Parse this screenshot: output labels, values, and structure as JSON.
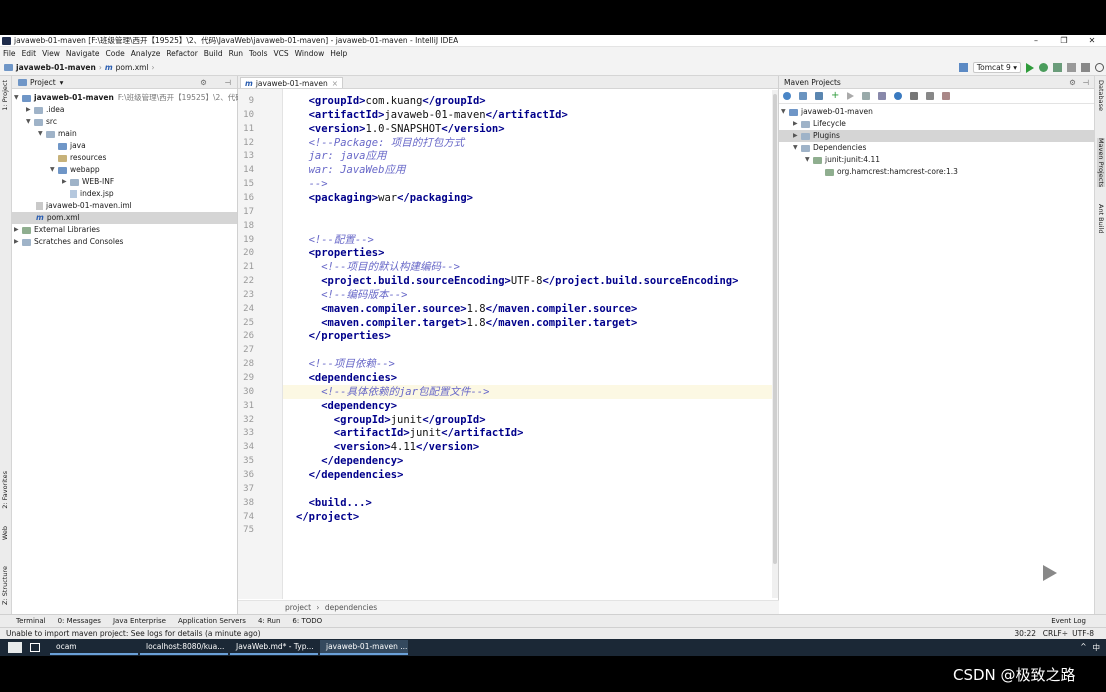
{
  "window": {
    "title": "javaweb-01-maven [F:\\班级管理\\西开【19525】\\2、代码\\JavaWeb\\javaweb-01-maven] - javaweb-01-maven - IntelliJ IDEA",
    "min": "–",
    "max": "❐",
    "close": "✕"
  },
  "menu": [
    "File",
    "Edit",
    "View",
    "Navigate",
    "Code",
    "Analyze",
    "Refactor",
    "Build",
    "Run",
    "Tools",
    "VCS",
    "Window",
    "Help"
  ],
  "nav": {
    "project": "javaweb-01-maven",
    "file": "pom.xml",
    "run_config": "Tomcat 9"
  },
  "left_strip": {
    "project": "1: Project",
    "favorites": "2: Favorites",
    "web": "Web",
    "structure": "Z: Structure"
  },
  "right_strip": {
    "database": "Database",
    "maven": "Maven Projects",
    "ant": "Ant Build"
  },
  "project_panel": {
    "header": "Project",
    "items": [
      {
        "label": "javaweb-01-maven",
        "path": "F:\\班级管理\\西开【19525】\\2、代码\\Java"
      },
      {
        "label": ".idea"
      },
      {
        "label": "src"
      },
      {
        "label": "main"
      },
      {
        "label": "java"
      },
      {
        "label": "resources"
      },
      {
        "label": "webapp"
      },
      {
        "label": "WEB-INF"
      },
      {
        "label": "index.jsp"
      },
      {
        "label": "javaweb-01-maven.iml"
      },
      {
        "label": "pom.xml"
      },
      {
        "label": "External Libraries"
      },
      {
        "label": "Scratches and Consoles"
      }
    ]
  },
  "editor": {
    "tab": "javaweb-01-maven",
    "current_line": 30,
    "lines": [
      {
        "n": "9",
        "parts": [
          [
            "tag",
            "<groupId>"
          ],
          [
            "txt",
            "com.kuang"
          ],
          [
            "tag",
            "</groupId>"
          ]
        ],
        "indent": 1
      },
      {
        "n": "10",
        "parts": [
          [
            "tag",
            "<artifactId>"
          ],
          [
            "txt",
            "javaweb-01-maven"
          ],
          [
            "tag",
            "</artifactId>"
          ]
        ],
        "indent": 1
      },
      {
        "n": "11",
        "parts": [
          [
            "tag",
            "<version>"
          ],
          [
            "txt",
            "1.0-SNAPSHOT"
          ],
          [
            "tag",
            "</version>"
          ]
        ],
        "indent": 1
      },
      {
        "n": "12",
        "parts": [
          [
            "cmt",
            "<!--Package: 项目的打包方式"
          ]
        ],
        "indent": 1
      },
      {
        "n": "13",
        "parts": [
          [
            "cmt",
            "jar: java应用"
          ]
        ],
        "indent": 1
      },
      {
        "n": "14",
        "parts": [
          [
            "cmt",
            "war: JavaWeb应用"
          ]
        ],
        "indent": 1
      },
      {
        "n": "15",
        "parts": [
          [
            "cmt",
            "-->"
          ]
        ],
        "indent": 1
      },
      {
        "n": "16",
        "parts": [
          [
            "tag",
            "<packaging>"
          ],
          [
            "txt",
            "war"
          ],
          [
            "tag",
            "</packaging>"
          ]
        ],
        "indent": 1
      },
      {
        "n": "17",
        "parts": [],
        "indent": 0
      },
      {
        "n": "18",
        "parts": [],
        "indent": 0
      },
      {
        "n": "19",
        "parts": [
          [
            "cmt",
            "<!--配置-->"
          ]
        ],
        "indent": 1
      },
      {
        "n": "20",
        "parts": [
          [
            "tag",
            "<properties>"
          ]
        ],
        "indent": 1
      },
      {
        "n": "21",
        "parts": [
          [
            "cmt",
            "<!--项目的默认构建编码-->"
          ]
        ],
        "indent": 2
      },
      {
        "n": "22",
        "parts": [
          [
            "tag",
            "<project.build.sourceEncoding>"
          ],
          [
            "txt",
            "UTF-8"
          ],
          [
            "tag",
            "</project.build.sourceEncoding>"
          ]
        ],
        "indent": 2
      },
      {
        "n": "23",
        "parts": [
          [
            "cmt",
            "<!--编码版本-->"
          ]
        ],
        "indent": 2
      },
      {
        "n": "24",
        "parts": [
          [
            "tag",
            "<maven.compiler.source>"
          ],
          [
            "txt",
            "1.8"
          ],
          [
            "tag",
            "</maven.compiler.source>"
          ]
        ],
        "indent": 2
      },
      {
        "n": "25",
        "parts": [
          [
            "tag",
            "<maven.compiler.target>"
          ],
          [
            "txt",
            "1.8"
          ],
          [
            "tag",
            "</maven.compiler.target>"
          ]
        ],
        "indent": 2
      },
      {
        "n": "26",
        "parts": [
          [
            "tag",
            "</properties>"
          ]
        ],
        "indent": 1
      },
      {
        "n": "27",
        "parts": [],
        "indent": 0
      },
      {
        "n": "28",
        "parts": [
          [
            "cmt",
            "<!--项目依赖-->"
          ]
        ],
        "indent": 1
      },
      {
        "n": "29",
        "parts": [
          [
            "tag",
            "<dependencies>"
          ]
        ],
        "indent": 1
      },
      {
        "n": "30",
        "parts": [
          [
            "cmt",
            "<!--具体依赖的jar包配置文件-->"
          ]
        ],
        "indent": 2
      },
      {
        "n": "31",
        "parts": [
          [
            "tag",
            "<dependency>"
          ]
        ],
        "indent": 2
      },
      {
        "n": "32",
        "parts": [
          [
            "tag",
            "<groupId>"
          ],
          [
            "txt",
            "junit"
          ],
          [
            "tag",
            "</groupId>"
          ]
        ],
        "indent": 3
      },
      {
        "n": "33",
        "parts": [
          [
            "tag",
            "<artifactId>"
          ],
          [
            "txt",
            "junit"
          ],
          [
            "tag",
            "</artifactId>"
          ]
        ],
        "indent": 3
      },
      {
        "n": "34",
        "parts": [
          [
            "tag",
            "<version>"
          ],
          [
            "txt",
            "4.11"
          ],
          [
            "tag",
            "</version>"
          ]
        ],
        "indent": 3
      },
      {
        "n": "35",
        "parts": [
          [
            "tag",
            "</dependency>"
          ]
        ],
        "indent": 2
      },
      {
        "n": "36",
        "parts": [
          [
            "tag",
            "</dependencies>"
          ]
        ],
        "indent": 1
      },
      {
        "n": "37",
        "parts": [],
        "indent": 0
      },
      {
        "n": "38",
        "parts": [
          [
            "tag",
            "<build...>"
          ]
        ],
        "indent": 1
      },
      {
        "n": "74",
        "parts": [
          [
            "tag",
            "</project>"
          ]
        ],
        "indent": 0
      },
      {
        "n": "75",
        "parts": [],
        "indent": 0
      }
    ],
    "breadcrumb": [
      "project",
      "dependencies"
    ]
  },
  "maven_panel": {
    "header": "Maven Projects",
    "items": [
      "javaweb-01-maven",
      "Lifecycle",
      "Plugins",
      "Dependencies",
      "junit:junit:4.11",
      "org.hamcrest:hamcrest-core:1.3"
    ]
  },
  "tool_windows": [
    "Terminal",
    "0: Messages",
    "Java Enterprise",
    "Application Servers",
    "4: Run",
    "6: TODO",
    "Event Log"
  ],
  "status": {
    "message": "Unable to import maven project: See logs for details (a minute ago)",
    "pos": "30:22",
    "crlf": "CRLF÷",
    "enc": "UTF-8"
  },
  "taskbar": {
    "tasks": [
      "ocam",
      "localhost:8080/kua...",
      "JavaWeb.md* - Typ...",
      "javaweb-01-maven ..."
    ],
    "tray": [
      "^",
      "中"
    ]
  },
  "watermark": "CSDN @极致之路"
}
